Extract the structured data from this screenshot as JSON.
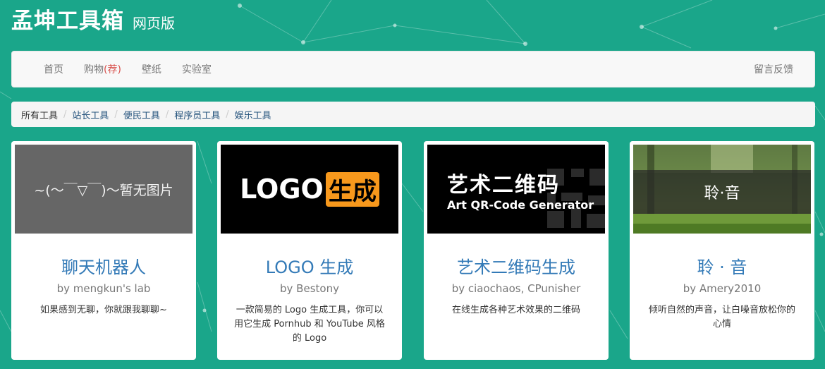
{
  "header": {
    "title": "孟坤工具箱",
    "subtitle": "网页版"
  },
  "nav": {
    "left": [
      {
        "label": "首页"
      },
      {
        "label": "购物",
        "hot": "(荐)"
      },
      {
        "label": "壁纸"
      },
      {
        "label": "实验室"
      }
    ],
    "right": "留言反馈"
  },
  "breadcrumb": [
    "所有工具",
    "站长工具",
    "便民工具",
    "程序员工具",
    "娱乐工具"
  ],
  "cards": [
    {
      "thumb_text": "~(～￣▽￣)～暂无图片",
      "title": "聊天机器人",
      "author": "by mengkun's lab",
      "desc": "如果感到无聊，你就跟我聊聊~"
    },
    {
      "thumb_text": "LOGO",
      "thumb_badge": "生成",
      "title": "LOGO 生成",
      "author": "by Bestony",
      "desc": "一款简易的 Logo 生成工具，你可以用它生成 Pornhub 和 YouTube 风格的 Logo"
    },
    {
      "thumb_text": "艺术二维码",
      "thumb_sub": "Art QR-Code Generator",
      "title": "艺术二维码生成",
      "author": "by ciaochaos, CPunisher",
      "desc": "在线生成各种艺术效果的二维码"
    },
    {
      "thumb_text": "聆·音",
      "title": "聆 · 音",
      "author": "by Amery2010",
      "desc": "倾听自然的声音，让白噪音放松你的心情"
    }
  ],
  "colors": {
    "background": "#1aa68a",
    "link": "#337ab7",
    "hot": "#d9534f",
    "logo_badge": "#f7981c"
  }
}
